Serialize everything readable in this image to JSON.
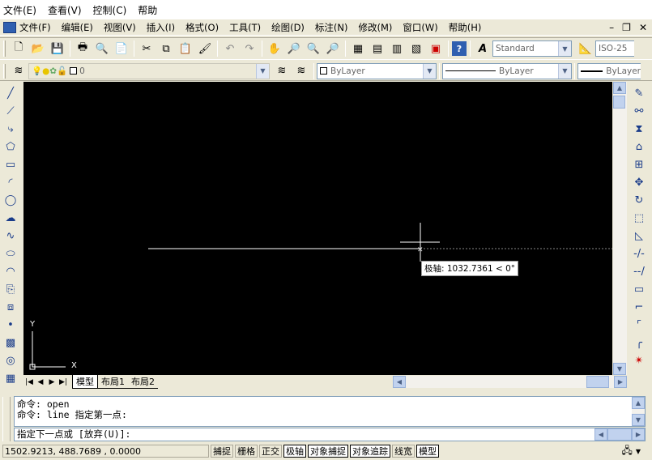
{
  "app_menu": [
    "文件(E)",
    "查看(V)",
    "控制(C)",
    "帮助"
  ],
  "doc_menu": [
    "文件(F)",
    "编辑(E)",
    "视图(V)",
    "插入(I)",
    "格式(O)",
    "工具(T)",
    "绘图(D)",
    "标注(N)",
    "修改(M)",
    "窗口(W)",
    "帮助(H)"
  ],
  "window_controls": {
    "minimize": "–",
    "restore": "❐",
    "close": "✕"
  },
  "toolbar": {
    "text_style": "Standard",
    "dim_style": "ISO-25"
  },
  "properties": {
    "layer": "0",
    "color": "ByLayer",
    "linetype": "ByLayer",
    "lineweight": "ByLayer"
  },
  "drawing": {
    "tooltip": "极轴: 1032.7361 < 0°",
    "ucs_y": "Y",
    "ucs_x": "X"
  },
  "tabs": [
    "模型",
    "布局1",
    "布局2"
  ],
  "command": {
    "history": [
      "命令: open",
      "命令: line 指定第一点:"
    ],
    "prompt": "指定下一点或 [放弃(U)]:"
  },
  "status": {
    "coords": "1502.9213, 488.7689 , 0.0000",
    "toggles": [
      {
        "label": "捕捉",
        "on": false
      },
      {
        "label": "栅格",
        "on": false
      },
      {
        "label": "正交",
        "on": false
      },
      {
        "label": "极轴",
        "on": true
      },
      {
        "label": "对象捕捉",
        "on": true
      },
      {
        "label": "对象追踪",
        "on": true
      },
      {
        "label": "线宽",
        "on": false
      },
      {
        "label": "模型",
        "on": true
      }
    ]
  }
}
